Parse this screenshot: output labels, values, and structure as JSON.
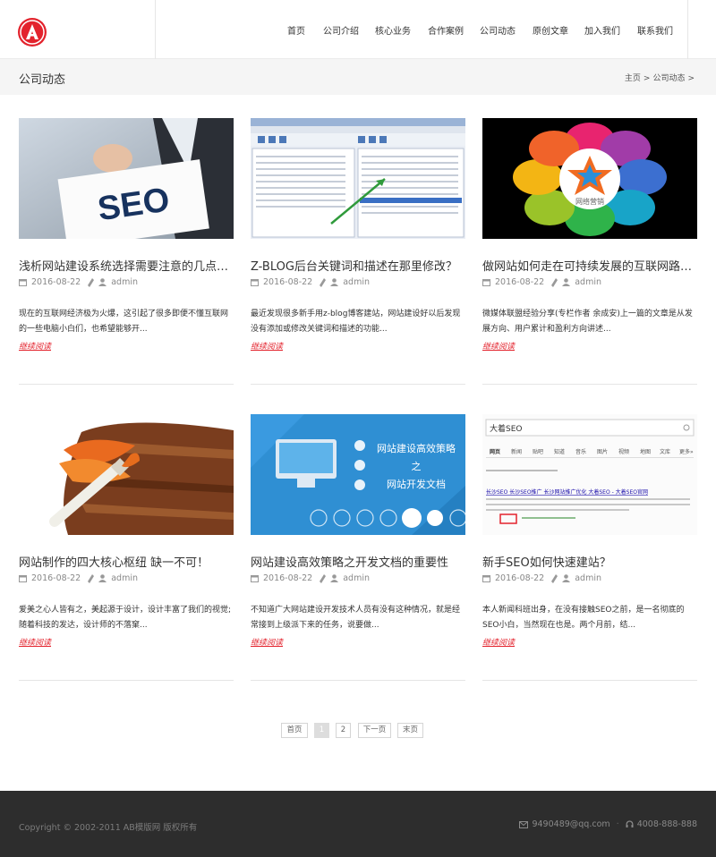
{
  "nav": {
    "items": [
      "首页",
      "公司介绍",
      "核心业务",
      "合作案例",
      "公司动态",
      "原创文章",
      "加入我们",
      "联系我们"
    ]
  },
  "titlebar": {
    "title": "公司动态",
    "breadcrumb": [
      "主页",
      "公司动态"
    ],
    "separator": ">"
  },
  "posts": [
    {
      "title": "浅析网站建设系统选择需要注意的几点事项",
      "date": "2016-08-22",
      "author": "admin",
      "excerpt": "现在的互联网经济极为火爆，这引起了很多即便不懂互联网的一些电脑小白们，也希望能够开...",
      "more": "继续阅读",
      "thumb_text": "SEO"
    },
    {
      "title": "Z-BLOG后台关键词和描述在那里修改？",
      "date": "2016-08-22",
      "author": "admin",
      "excerpt": "最近发现很多新手用z-blog博客建站，网站建设好以后发现没有添加或修改关键词和描述的功能...",
      "more": "继续阅读",
      "thumb_text": ""
    },
    {
      "title": "做网站如何走在可持续发展的互联网路上？",
      "date": "2016-08-22",
      "author": "admin",
      "excerpt": "微媒体联盟经验分享(专栏作者 余成安)上一篇的文章是从发展方向、用户累计和盈利方向讲述...",
      "more": "继续阅读",
      "thumb_text": "网络营销"
    },
    {
      "title": "网站制作的四大核心枢纽 缺一不可！",
      "date": "2016-08-22",
      "author": "admin",
      "excerpt": "爱美之心人皆有之，美起源于设计，设计丰富了我们的视觉;随着科技的发达，设计师的不落窠...",
      "more": "继续阅读",
      "thumb_text": ""
    },
    {
      "title": "网站建设高效策略之开发文档的重要性",
      "date": "2016-08-22",
      "author": "admin",
      "excerpt": "不知道广大网站建设开发技术人员有没有这种情况，就是经常接到上级派下来的任务，说要做...",
      "more": "继续阅读",
      "thumb_lines": [
        "网站建设高效策略",
        "之",
        "网站开发文档"
      ]
    },
    {
      "title": "新手SEO如何快速建站？",
      "date": "2016-08-22",
      "author": "admin",
      "excerpt": "本人新闻科班出身，在没有接触SEO之前，是一名彻底的SEO小白，当然现在也是。两个月前，结...",
      "more": "继续阅读",
      "thumb_search": "大着SEO",
      "thumb_tabs": [
        "网页",
        "新闻",
        "贴吧",
        "知道",
        "音乐",
        "图片",
        "视频",
        "地图",
        "文库",
        "更多»"
      ],
      "thumb_result": "长沙SEO 长沙SEO推广 长沙网站推广优化 大着SEO - 大着SEO官网"
    }
  ],
  "pagination": {
    "items": [
      "首页",
      "1",
      "2",
      "下一页",
      "末页"
    ],
    "active": "1"
  },
  "footer": {
    "copyright": "Copyright © 2002-2011 AB模版网 版权所有",
    "email": "9490489@qq.com",
    "phone": "4008-888-888"
  },
  "colors": {
    "accent": "#e3232d",
    "footer_bg": "#2d2d2d",
    "titlebar_bg": "#f5f5f5"
  }
}
